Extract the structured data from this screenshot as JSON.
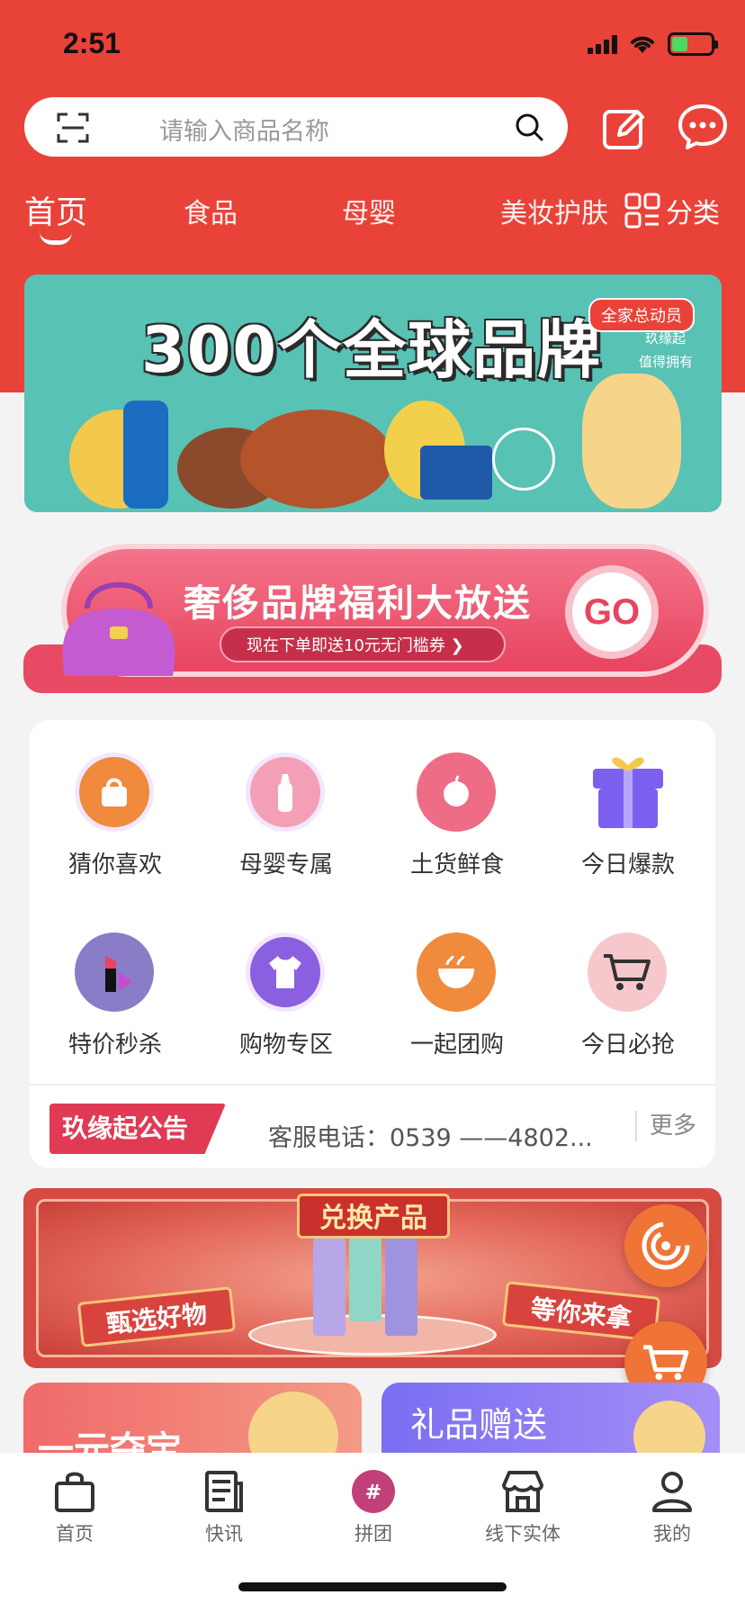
{
  "status_bar": {
    "time": "2:51"
  },
  "search": {
    "placeholder": "请输入商品名称"
  },
  "categories": {
    "tabs": [
      "首页",
      "食品",
      "母婴",
      "美妆护肤"
    ],
    "category_label": "分类"
  },
  "banners": {
    "top": {
      "title": "300个全球品牌",
      "tag": "全家总动员",
      "line1": "玖缘起",
      "line2": "值得拥有"
    },
    "luxury": {
      "title": "奢侈品牌福利大放送",
      "subtitle": "现在下单即送10元无门槛券 ❯",
      "go": "GO"
    },
    "exchange": {
      "title": "兑换产品",
      "left": "甄选好物",
      "right": "等你来拿"
    }
  },
  "features": [
    {
      "label": "猜你喜欢",
      "icon": "shopping-bag-icon"
    },
    {
      "label": "母婴专属",
      "icon": "baby-bottle-icon"
    },
    {
      "label": "土货鲜食",
      "icon": "apple-icon"
    },
    {
      "label": "今日爆款",
      "icon": "gift-icon"
    },
    {
      "label": "特价秒杀",
      "icon": "lipstick-icon"
    },
    {
      "label": "购物专区",
      "icon": "tshirt-icon"
    },
    {
      "label": "一起团购",
      "icon": "noodle-bowl-icon"
    },
    {
      "label": "今日必抢",
      "icon": "shopping-cart-icon"
    }
  ],
  "notice": {
    "badge": "玖缘起公告",
    "text": "客服电话：0539 ——4802...",
    "more": "更多"
  },
  "promos": {
    "left": "一元夺宝",
    "right": "礼品赠送"
  },
  "tabbar": [
    {
      "label": "首页",
      "icon": "bag-icon"
    },
    {
      "label": "快讯",
      "icon": "news-icon"
    },
    {
      "label": "拼团",
      "icon": "group-buy-icon"
    },
    {
      "label": "线下实体",
      "icon": "store-icon"
    },
    {
      "label": "我的",
      "icon": "user-icon"
    }
  ],
  "colors": {
    "brand_red": "#e94239",
    "accent_pink": "#e8445f",
    "orange": "#f07435"
  }
}
